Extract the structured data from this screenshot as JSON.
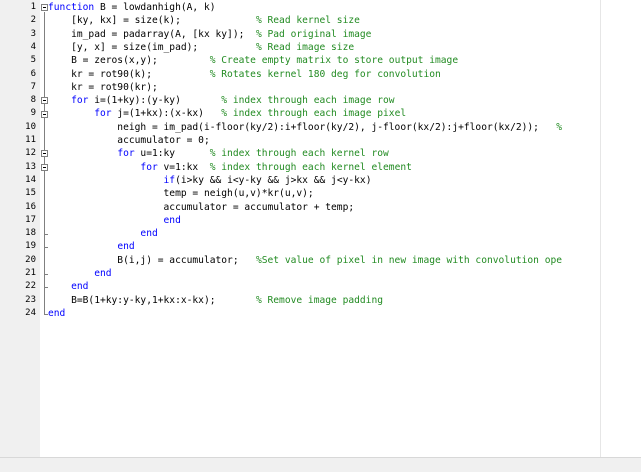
{
  "editor": {
    "lines": [
      {
        "n": "1",
        "parts": [
          {
            "t": "kw",
            "s": "function"
          },
          {
            "t": "tx",
            "s": " B = lowdanhigh(A, k)"
          }
        ]
      },
      {
        "n": "2",
        "parts": [
          {
            "t": "tx",
            "s": "    [ky, kx] = size(k);             "
          },
          {
            "t": "cm",
            "s": "% Read kernel size"
          }
        ]
      },
      {
        "n": "3",
        "parts": [
          {
            "t": "tx",
            "s": "    im_pad = padarray(A, [kx ky]);  "
          },
          {
            "t": "cm",
            "s": "% Pad original image"
          }
        ]
      },
      {
        "n": "4",
        "parts": [
          {
            "t": "tx",
            "s": "    [y, x] = size(im_pad);          "
          },
          {
            "t": "cm",
            "s": "% Read image size"
          }
        ]
      },
      {
        "n": "5",
        "parts": [
          {
            "t": "tx",
            "s": "    B = zeros(x,y);         "
          },
          {
            "t": "cm",
            "s": "% Create empty matrix to store output image"
          }
        ]
      },
      {
        "n": "6",
        "parts": [
          {
            "t": "tx",
            "s": "    kr = rot90(k);          "
          },
          {
            "t": "cm",
            "s": "% Rotates kernel 180 deg for convolution"
          }
        ]
      },
      {
        "n": "7",
        "parts": [
          {
            "t": "tx",
            "s": "    kr = rot90(kr);"
          }
        ]
      },
      {
        "n": "8",
        "parts": [
          {
            "t": "tx",
            "s": "    "
          },
          {
            "t": "kw",
            "s": "for"
          },
          {
            "t": "tx",
            "s": " i=(1+ky):(y-ky)       "
          },
          {
            "t": "cm",
            "s": "% index through each image row"
          }
        ]
      },
      {
        "n": "9",
        "parts": [
          {
            "t": "tx",
            "s": "        "
          },
          {
            "t": "kw",
            "s": "for"
          },
          {
            "t": "tx",
            "s": " j=(1+kx):(x-kx)   "
          },
          {
            "t": "cm",
            "s": "% index through each image pixel"
          }
        ]
      },
      {
        "n": "10",
        "parts": [
          {
            "t": "tx",
            "s": "            neigh = im_pad(i-floor(ky/2):i+floor(ky/2), j-floor(kx/2):j+floor(kx/2));   "
          },
          {
            "t": "cm",
            "s": "%"
          }
        ]
      },
      {
        "n": "11",
        "parts": [
          {
            "t": "tx",
            "s": "            accumulator = 0;"
          }
        ]
      },
      {
        "n": "12",
        "parts": [
          {
            "t": "tx",
            "s": "            "
          },
          {
            "t": "kw",
            "s": "for"
          },
          {
            "t": "tx",
            "s": " u=1:ky      "
          },
          {
            "t": "cm",
            "s": "% index through each kernel row"
          }
        ]
      },
      {
        "n": "13",
        "parts": [
          {
            "t": "tx",
            "s": "                "
          },
          {
            "t": "kw",
            "s": "for"
          },
          {
            "t": "tx",
            "s": " v=1:kx  "
          },
          {
            "t": "cm",
            "s": "% index through each kernel element"
          }
        ]
      },
      {
        "n": "14",
        "parts": [
          {
            "t": "tx",
            "s": "                    "
          },
          {
            "t": "kw",
            "s": "if"
          },
          {
            "t": "tx",
            "s": "(i>ky && i<y-ky && j>kx && j<y-kx)"
          }
        ]
      },
      {
        "n": "15",
        "parts": [
          {
            "t": "tx",
            "s": "                    temp = neigh(u,v)*kr(u,v);"
          }
        ]
      },
      {
        "n": "16",
        "parts": [
          {
            "t": "tx",
            "s": "                    accumulator = accumulator + temp;"
          }
        ]
      },
      {
        "n": "17",
        "parts": [
          {
            "t": "tx",
            "s": "                    "
          },
          {
            "t": "kw",
            "s": "end"
          }
        ]
      },
      {
        "n": "18",
        "parts": [
          {
            "t": "tx",
            "s": "                "
          },
          {
            "t": "kw",
            "s": "end"
          }
        ]
      },
      {
        "n": "19",
        "parts": [
          {
            "t": "tx",
            "s": "            "
          },
          {
            "t": "kw",
            "s": "end"
          }
        ]
      },
      {
        "n": "20",
        "parts": [
          {
            "t": "tx",
            "s": "            B(i,j) = accumulator;   "
          },
          {
            "t": "cm",
            "s": "%Set value of pixel in new image with convolution ope"
          }
        ]
      },
      {
        "n": "21",
        "parts": [
          {
            "t": "tx",
            "s": "        "
          },
          {
            "t": "kw",
            "s": "end"
          }
        ]
      },
      {
        "n": "22",
        "parts": [
          {
            "t": "tx",
            "s": "    "
          },
          {
            "t": "kw",
            "s": "end"
          }
        ]
      },
      {
        "n": "23",
        "parts": [
          {
            "t": "tx",
            "s": "    B=B(1+ky:y-ky,1+kx:x-kx);       "
          },
          {
            "t": "cm",
            "s": "% Remove image padding"
          }
        ]
      },
      {
        "n": "24",
        "parts": [
          {
            "t": "kw",
            "s": "end"
          }
        ]
      }
    ],
    "fold_markers": [
      "1",
      "8",
      "9",
      "12",
      "13"
    ],
    "colors": {
      "keyword": "#0000ff",
      "comment": "#228b22",
      "text": "#000000",
      "gutter": "#f0f0f0"
    }
  }
}
